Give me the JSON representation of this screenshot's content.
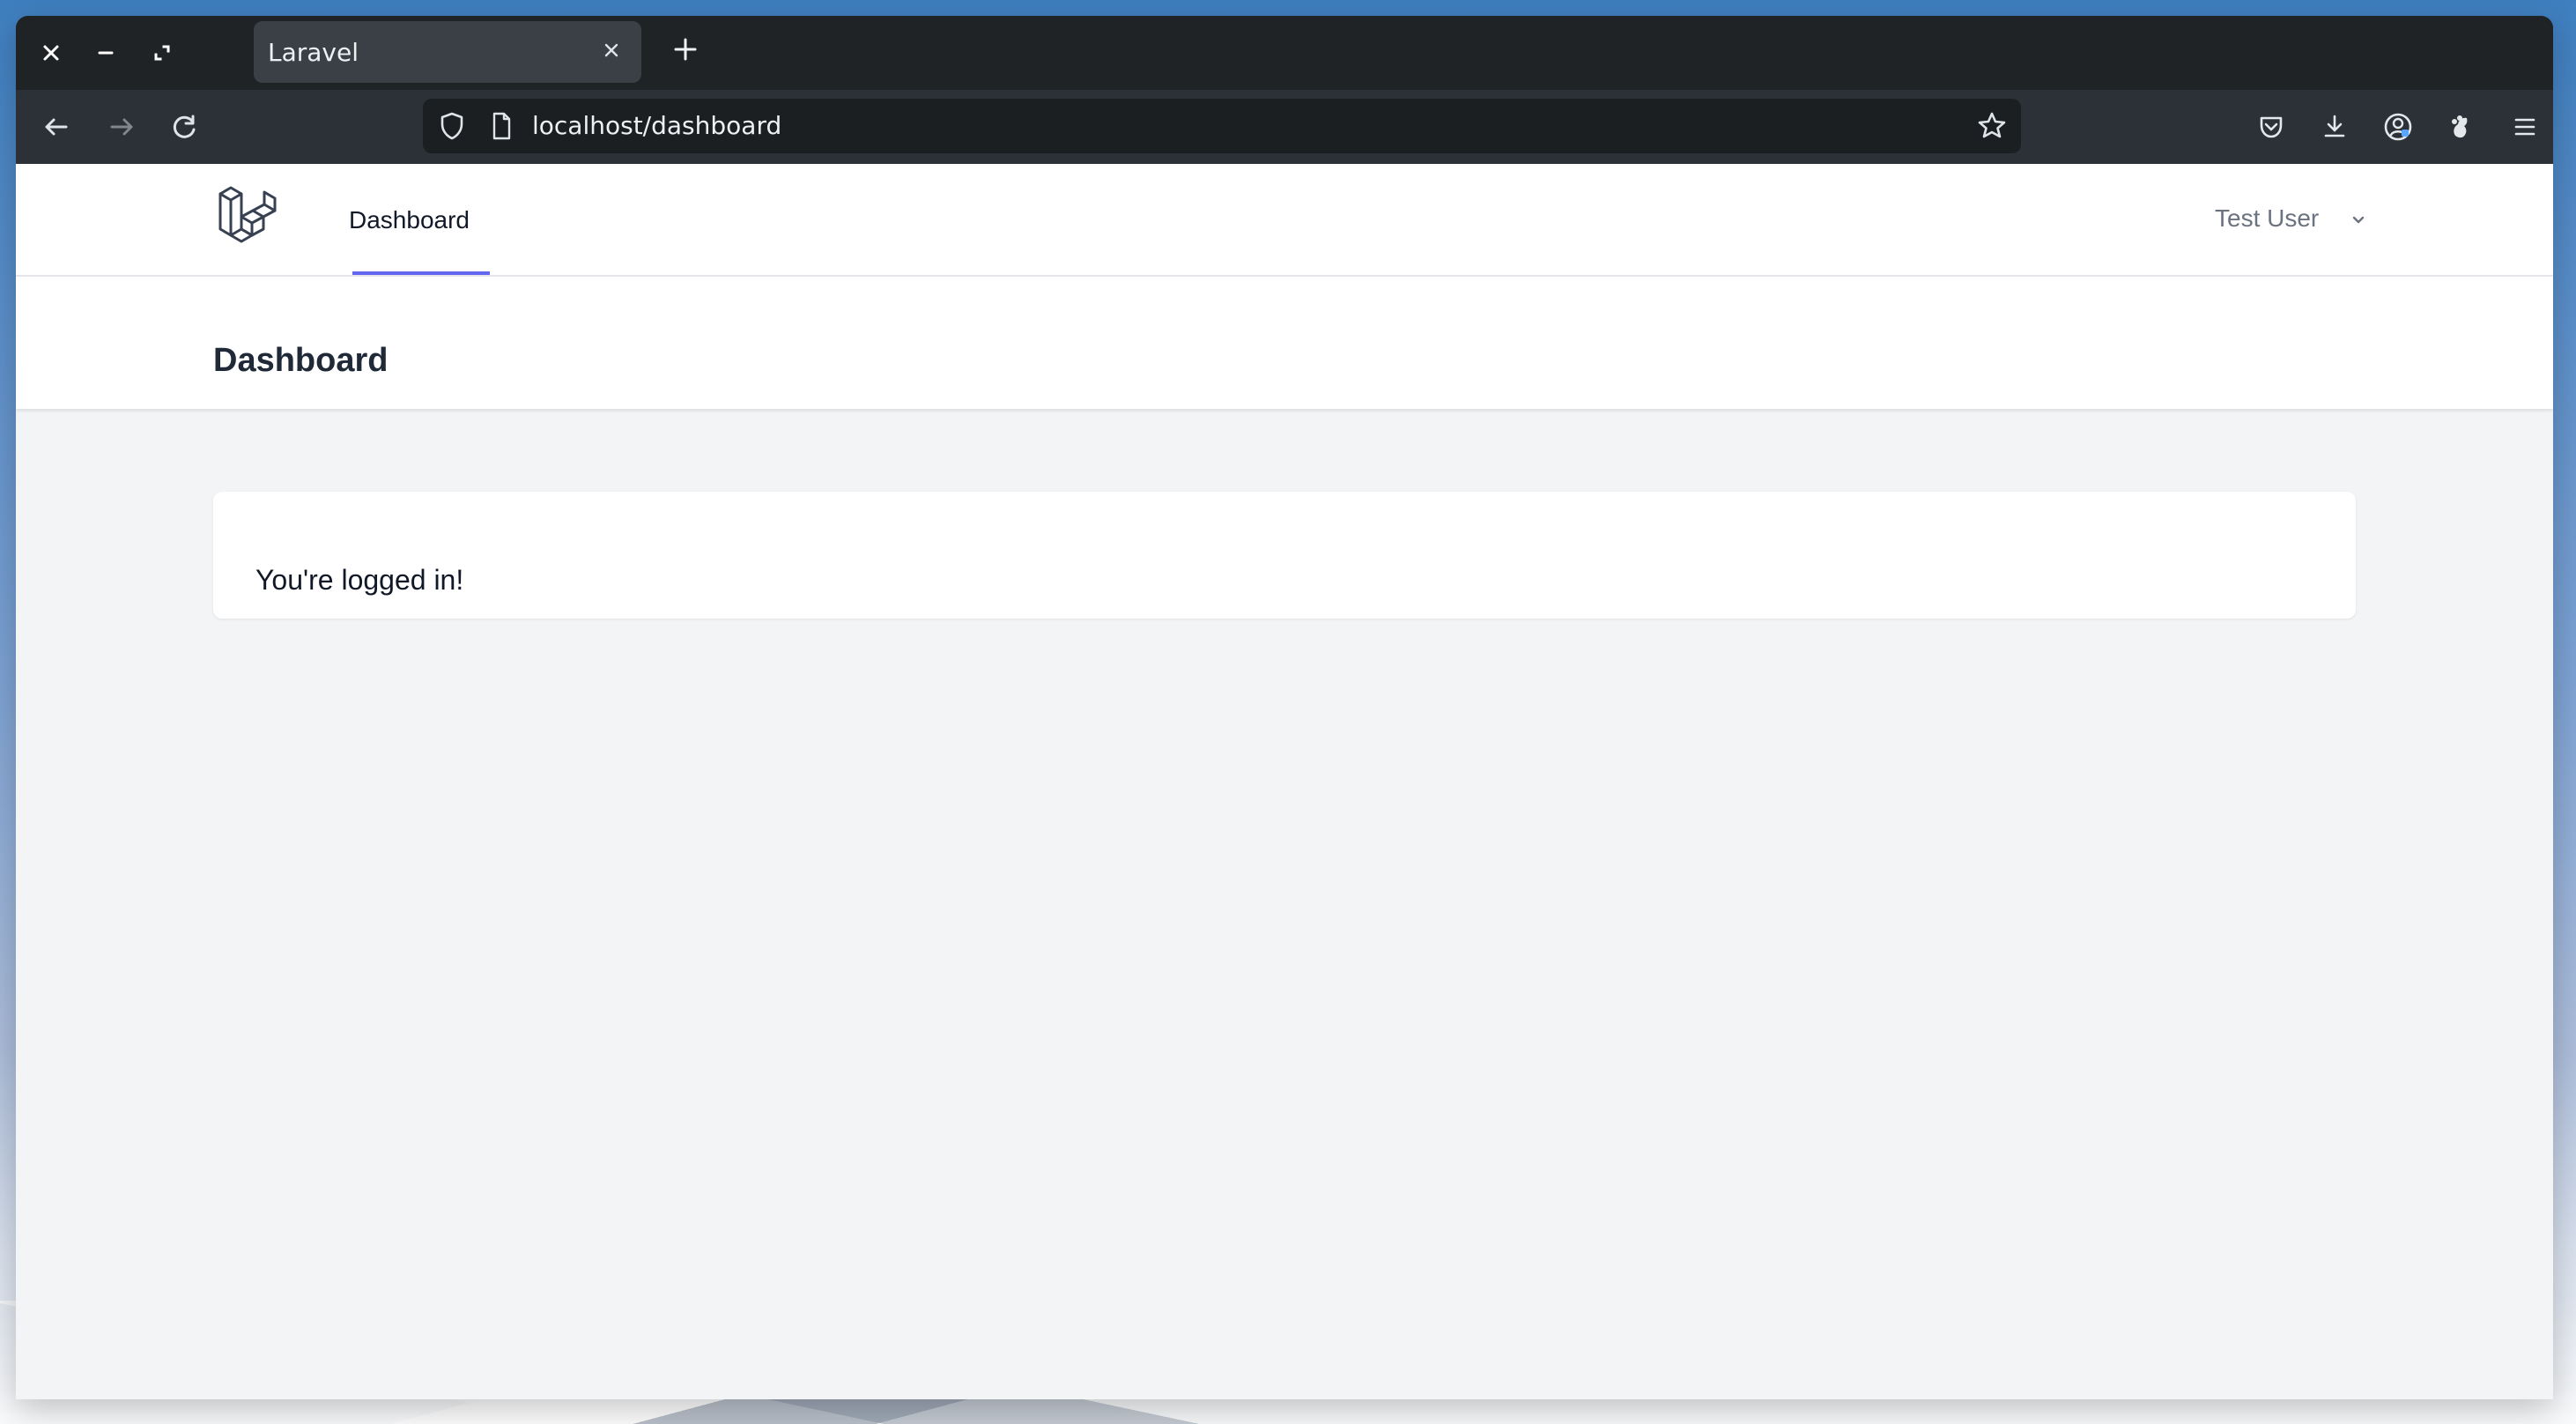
{
  "browser": {
    "tab": {
      "title": "Laravel"
    },
    "address_bar": {
      "url": "localhost/dashboard"
    },
    "icons": {
      "window_close": "close-icon",
      "window_minimize": "minimize-icon",
      "window_maximize": "maximize-icon",
      "new_tab": "plus-icon",
      "back": "arrow-left-icon",
      "forward": "arrow-right-icon",
      "reload": "reload-icon",
      "site_security": "shield-icon",
      "page": "page-icon",
      "bookmark": "star-icon",
      "pocket": "pocket-icon",
      "downloads": "download-icon",
      "account": "account-icon",
      "extension": "extension-icon",
      "menu": "menu-icon"
    },
    "colors": {
      "chrome_dark": "#1f2326",
      "toolbar_dark": "#2b3136",
      "tab_active": "#3a4045",
      "url_bar": "#1b1f22"
    }
  },
  "app": {
    "nav": {
      "links": [
        {
          "label": "Dashboard",
          "active": true
        }
      ],
      "user": {
        "name": "Test User"
      },
      "accent_color": "#6366f1"
    },
    "header": {
      "title": "Dashboard"
    },
    "main": {
      "message": "You're logged in!"
    },
    "colors": {
      "page_background": "#f3f4f6",
      "surface": "#ffffff",
      "heading_text": "#1f2937",
      "muted_text": "#6b7280"
    },
    "icons": {
      "logo": "laravel-logo-icon",
      "user_menu": "chevron-down-icon"
    }
  }
}
